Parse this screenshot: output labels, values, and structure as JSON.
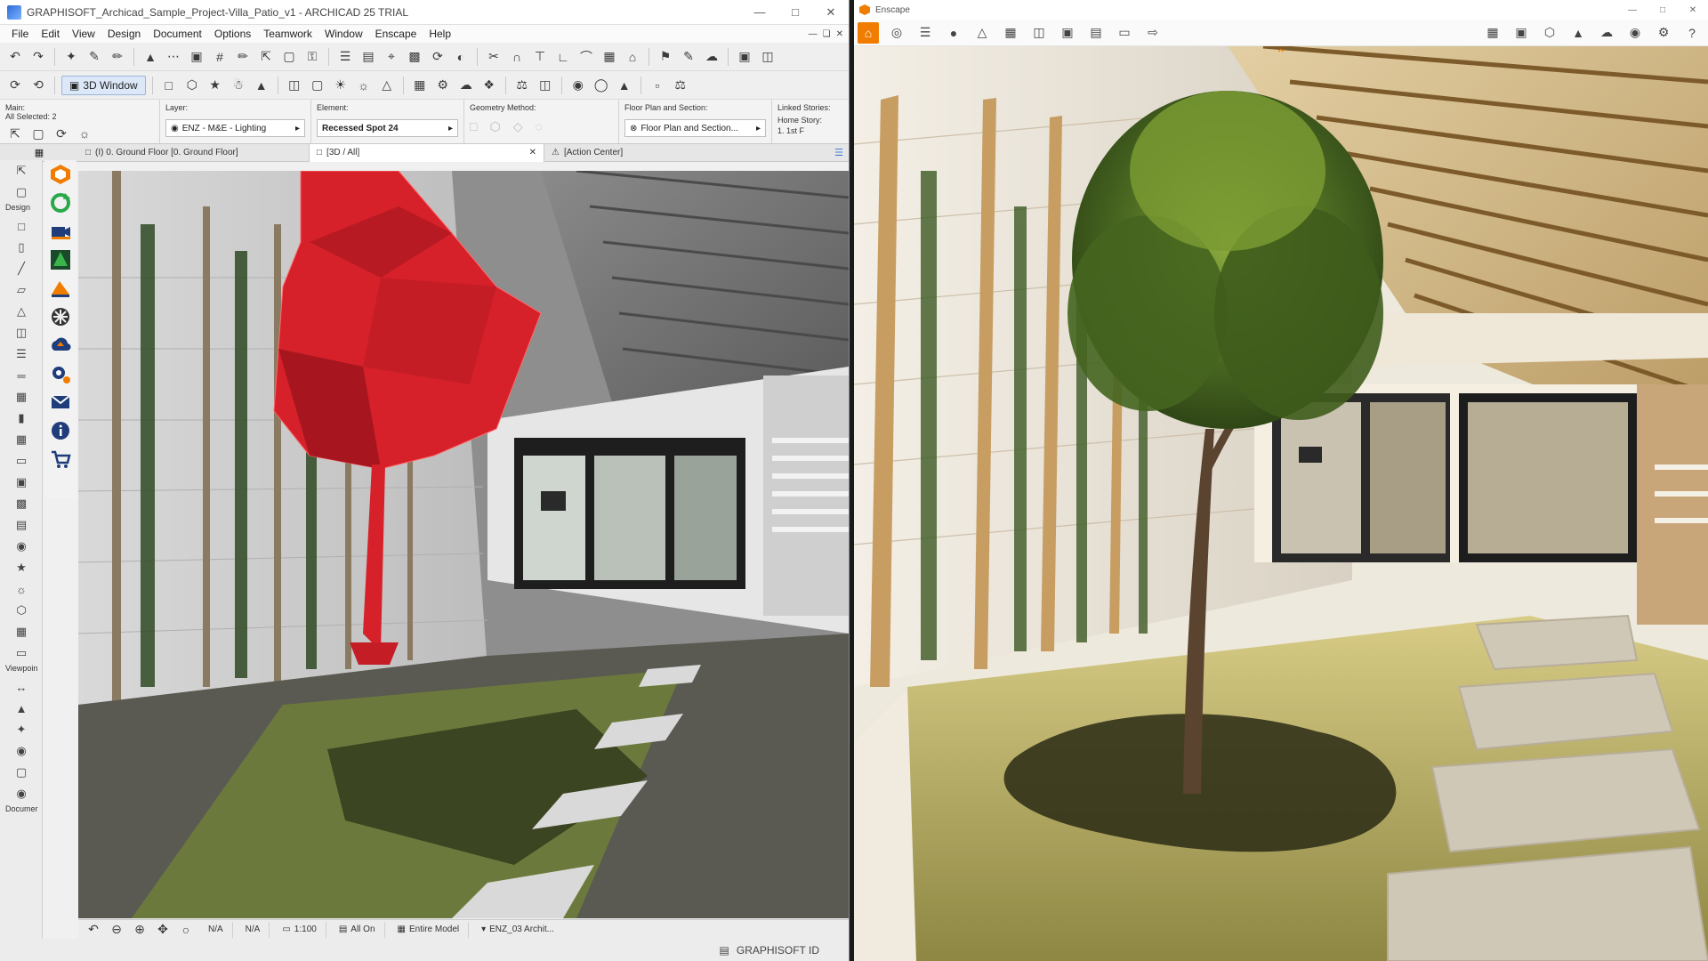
{
  "archicad": {
    "title": "GRAPHISOFT_Archicad_Sample_Project-Villa_Patio_v1 - ARCHICAD 25 TRIAL",
    "menu": [
      "File",
      "Edit",
      "View",
      "Design",
      "Document",
      "Options",
      "Teamwork",
      "Window",
      "Enscape",
      "Help"
    ],
    "toolbar": {
      "window_button": "3D Window"
    },
    "infobox": {
      "main_label": "Main:",
      "selection_count": "All Selected: 2",
      "layer_label": "Layer:",
      "layer_value": "ENZ - M&E - Lighting",
      "element_label": "Element:",
      "element_value": "Recessed Spot 24",
      "geometry_label": "Geometry Method:",
      "floorplan_label": "Floor Plan and Section:",
      "floorplan_value": "Floor Plan and Section...",
      "linked_label": "Linked Stories:",
      "home_story_label": "Home Story:",
      "home_story_value": "1. 1st F"
    },
    "tabs": [
      {
        "label": "(I) 0. Ground Floor [0. Ground Floor]"
      },
      {
        "label": "[3D / All]"
      },
      {
        "label": "[Action Center]"
      }
    ],
    "toolbox": {
      "design_caption": "Design",
      "viewpoint_caption": "Viewpoin",
      "document_caption": "Documer"
    },
    "statusbar": {
      "field1": "N/A",
      "field2": "N/A",
      "scale": "1:100",
      "layers": "All On",
      "model": "Entire Model",
      "override": "ENZ_03 Archit..."
    },
    "footer": {
      "graphisoft_id": "GRAPHISOFT ID"
    }
  },
  "enscape": {
    "title": "Enscape",
    "accent_color": "#f07d00"
  },
  "colors": {
    "tree_selection": "#d6202a",
    "grass_dark": "#3f4a23",
    "grass_light": "#b9a95a"
  }
}
